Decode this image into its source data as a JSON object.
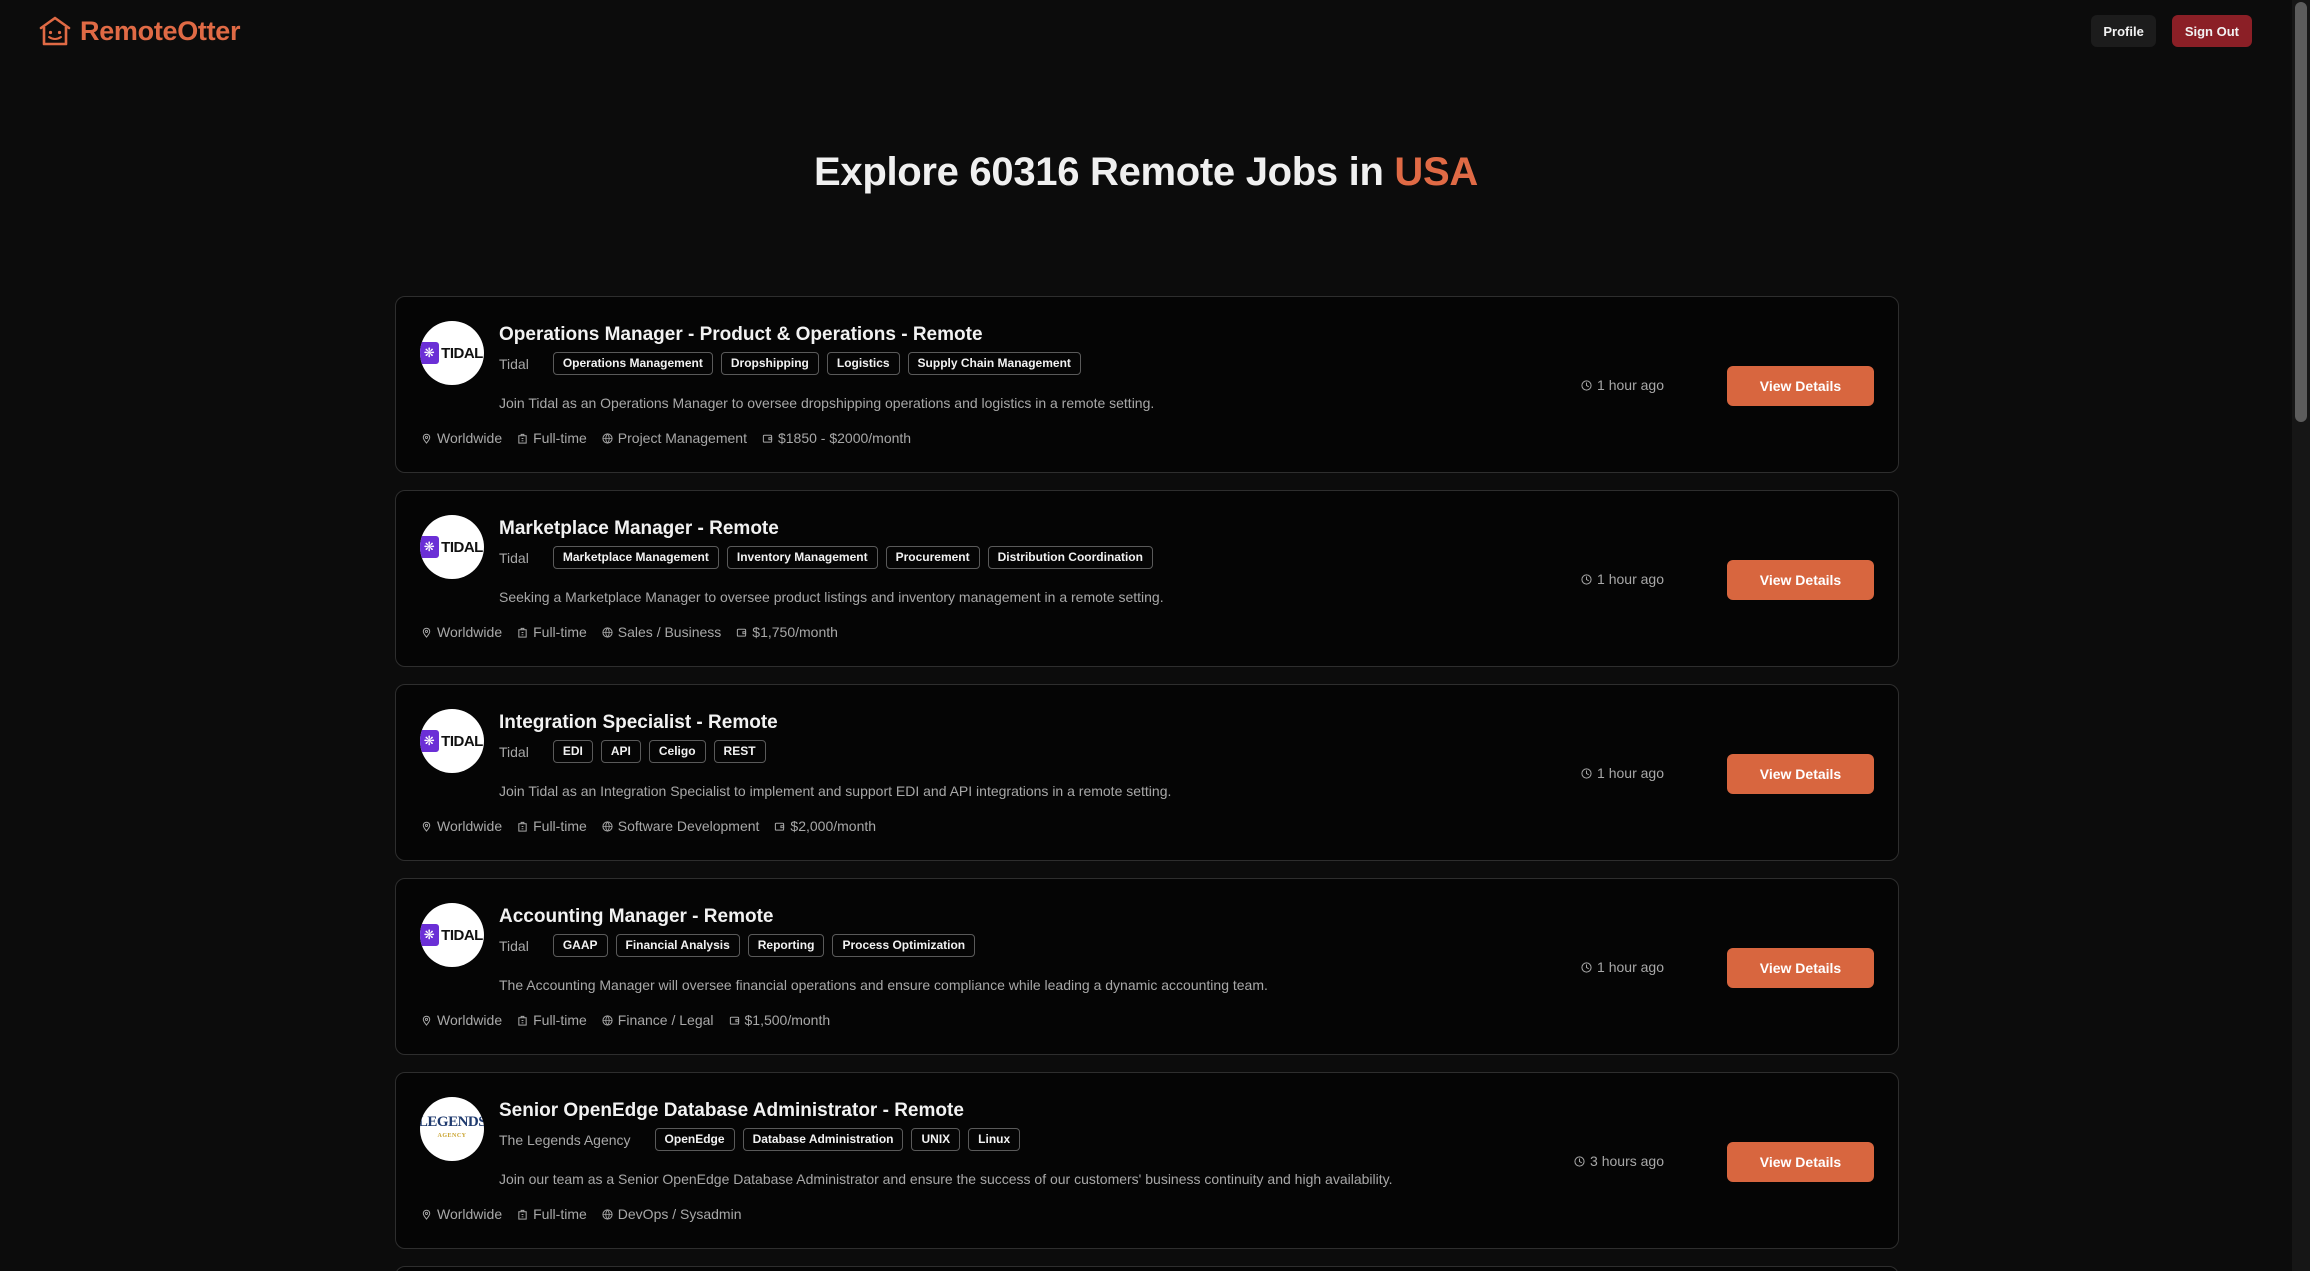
{
  "app": {
    "logo_text": "RemoteOtter",
    "brand_color": "#e06a45"
  },
  "header": {
    "profile_label": "Profile",
    "signout_label": "Sign Out"
  },
  "hero": {
    "prefix": "Explore 60316 Remote Jobs in ",
    "accent": "USA"
  },
  "jobs": [
    {
      "title": "Operations Manager - Product & Operations - Remote",
      "company": "Tidal",
      "logo": "tidal",
      "tags": [
        "Operations Management",
        "Dropshipping",
        "Logistics",
        "Supply Chain Management"
      ],
      "description": "Join Tidal as an Operations Manager to oversee dropshipping operations and logistics in a remote setting.",
      "location": "Worldwide",
      "type": "Full-time",
      "category": "Project Management",
      "salary": "$1850 - $2000/month",
      "posted": "1 hour ago",
      "button": "View Details"
    },
    {
      "title": "Marketplace Manager - Remote",
      "company": "Tidal",
      "logo": "tidal",
      "tags": [
        "Marketplace Management",
        "Inventory Management",
        "Procurement",
        "Distribution Coordination"
      ],
      "description": "Seeking a Marketplace Manager to oversee product listings and inventory management in a remote setting.",
      "location": "Worldwide",
      "type": "Full-time",
      "category": "Sales / Business",
      "salary": "$1,750/month",
      "posted": "1 hour ago",
      "button": "View Details"
    },
    {
      "title": "Integration Specialist - Remote",
      "company": "Tidal",
      "logo": "tidal",
      "tags": [
        "EDI",
        "API",
        "Celigo",
        "REST"
      ],
      "description": "Join Tidal as an Integration Specialist to implement and support EDI and API integrations in a remote setting.",
      "location": "Worldwide",
      "type": "Full-time",
      "category": "Software Development",
      "salary": "$2,000/month",
      "posted": "1 hour ago",
      "button": "View Details"
    },
    {
      "title": "Accounting Manager - Remote",
      "company": "Tidal",
      "logo": "tidal",
      "tags": [
        "GAAP",
        "Financial Analysis",
        "Reporting",
        "Process Optimization"
      ],
      "description": "The Accounting Manager will oversee financial operations and ensure compliance while leading a dynamic accounting team.",
      "location": "Worldwide",
      "type": "Full-time",
      "category": "Finance / Legal",
      "salary": "$1,500/month",
      "posted": "1 hour ago",
      "button": "View Details"
    },
    {
      "title": "Senior OpenEdge Database Administrator - Remote",
      "company": "The Legends Agency",
      "logo": "legends",
      "tags": [
        "OpenEdge",
        "Database Administration",
        "UNIX",
        "Linux"
      ],
      "description": "Join our team as a Senior OpenEdge Database Administrator and ensure the success of our customers' business continuity and high availability.",
      "location": "Worldwide",
      "type": "Full-time",
      "category": "DevOps / Sysadmin",
      "salary": "",
      "posted": "3 hours ago",
      "button": "View Details"
    }
  ]
}
